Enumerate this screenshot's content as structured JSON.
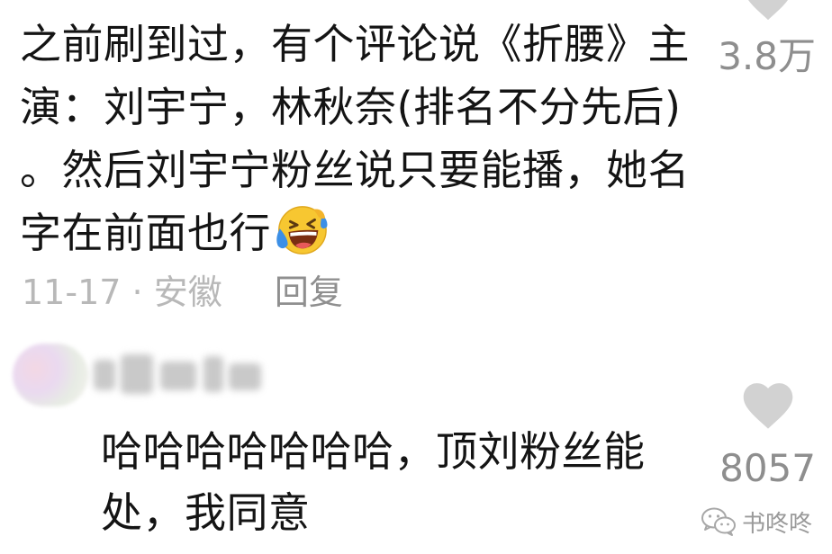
{
  "comment1": {
    "text": "之前刷到过，有个评论说《折腰》主演：刘宇宁，林秋奈(排名不分先后) 。然后刘宇宁粉丝说只要能播，她名字在前面也行",
    "emoji": "laughing-crying-face",
    "date": "11-17",
    "separator": "·",
    "location": "安徽",
    "reply_label": "回复",
    "likes": "3.8万"
  },
  "comment2": {
    "text": "哈哈哈哈哈哈哈，顶刘粉丝能处，我同意",
    "likes": "8057"
  },
  "watermark": {
    "text": "书咚咚"
  },
  "colors": {
    "text": "#141414",
    "meta": "#b8b8b8",
    "likes": "#8e8e8e",
    "heart": "#cfcfcf"
  }
}
